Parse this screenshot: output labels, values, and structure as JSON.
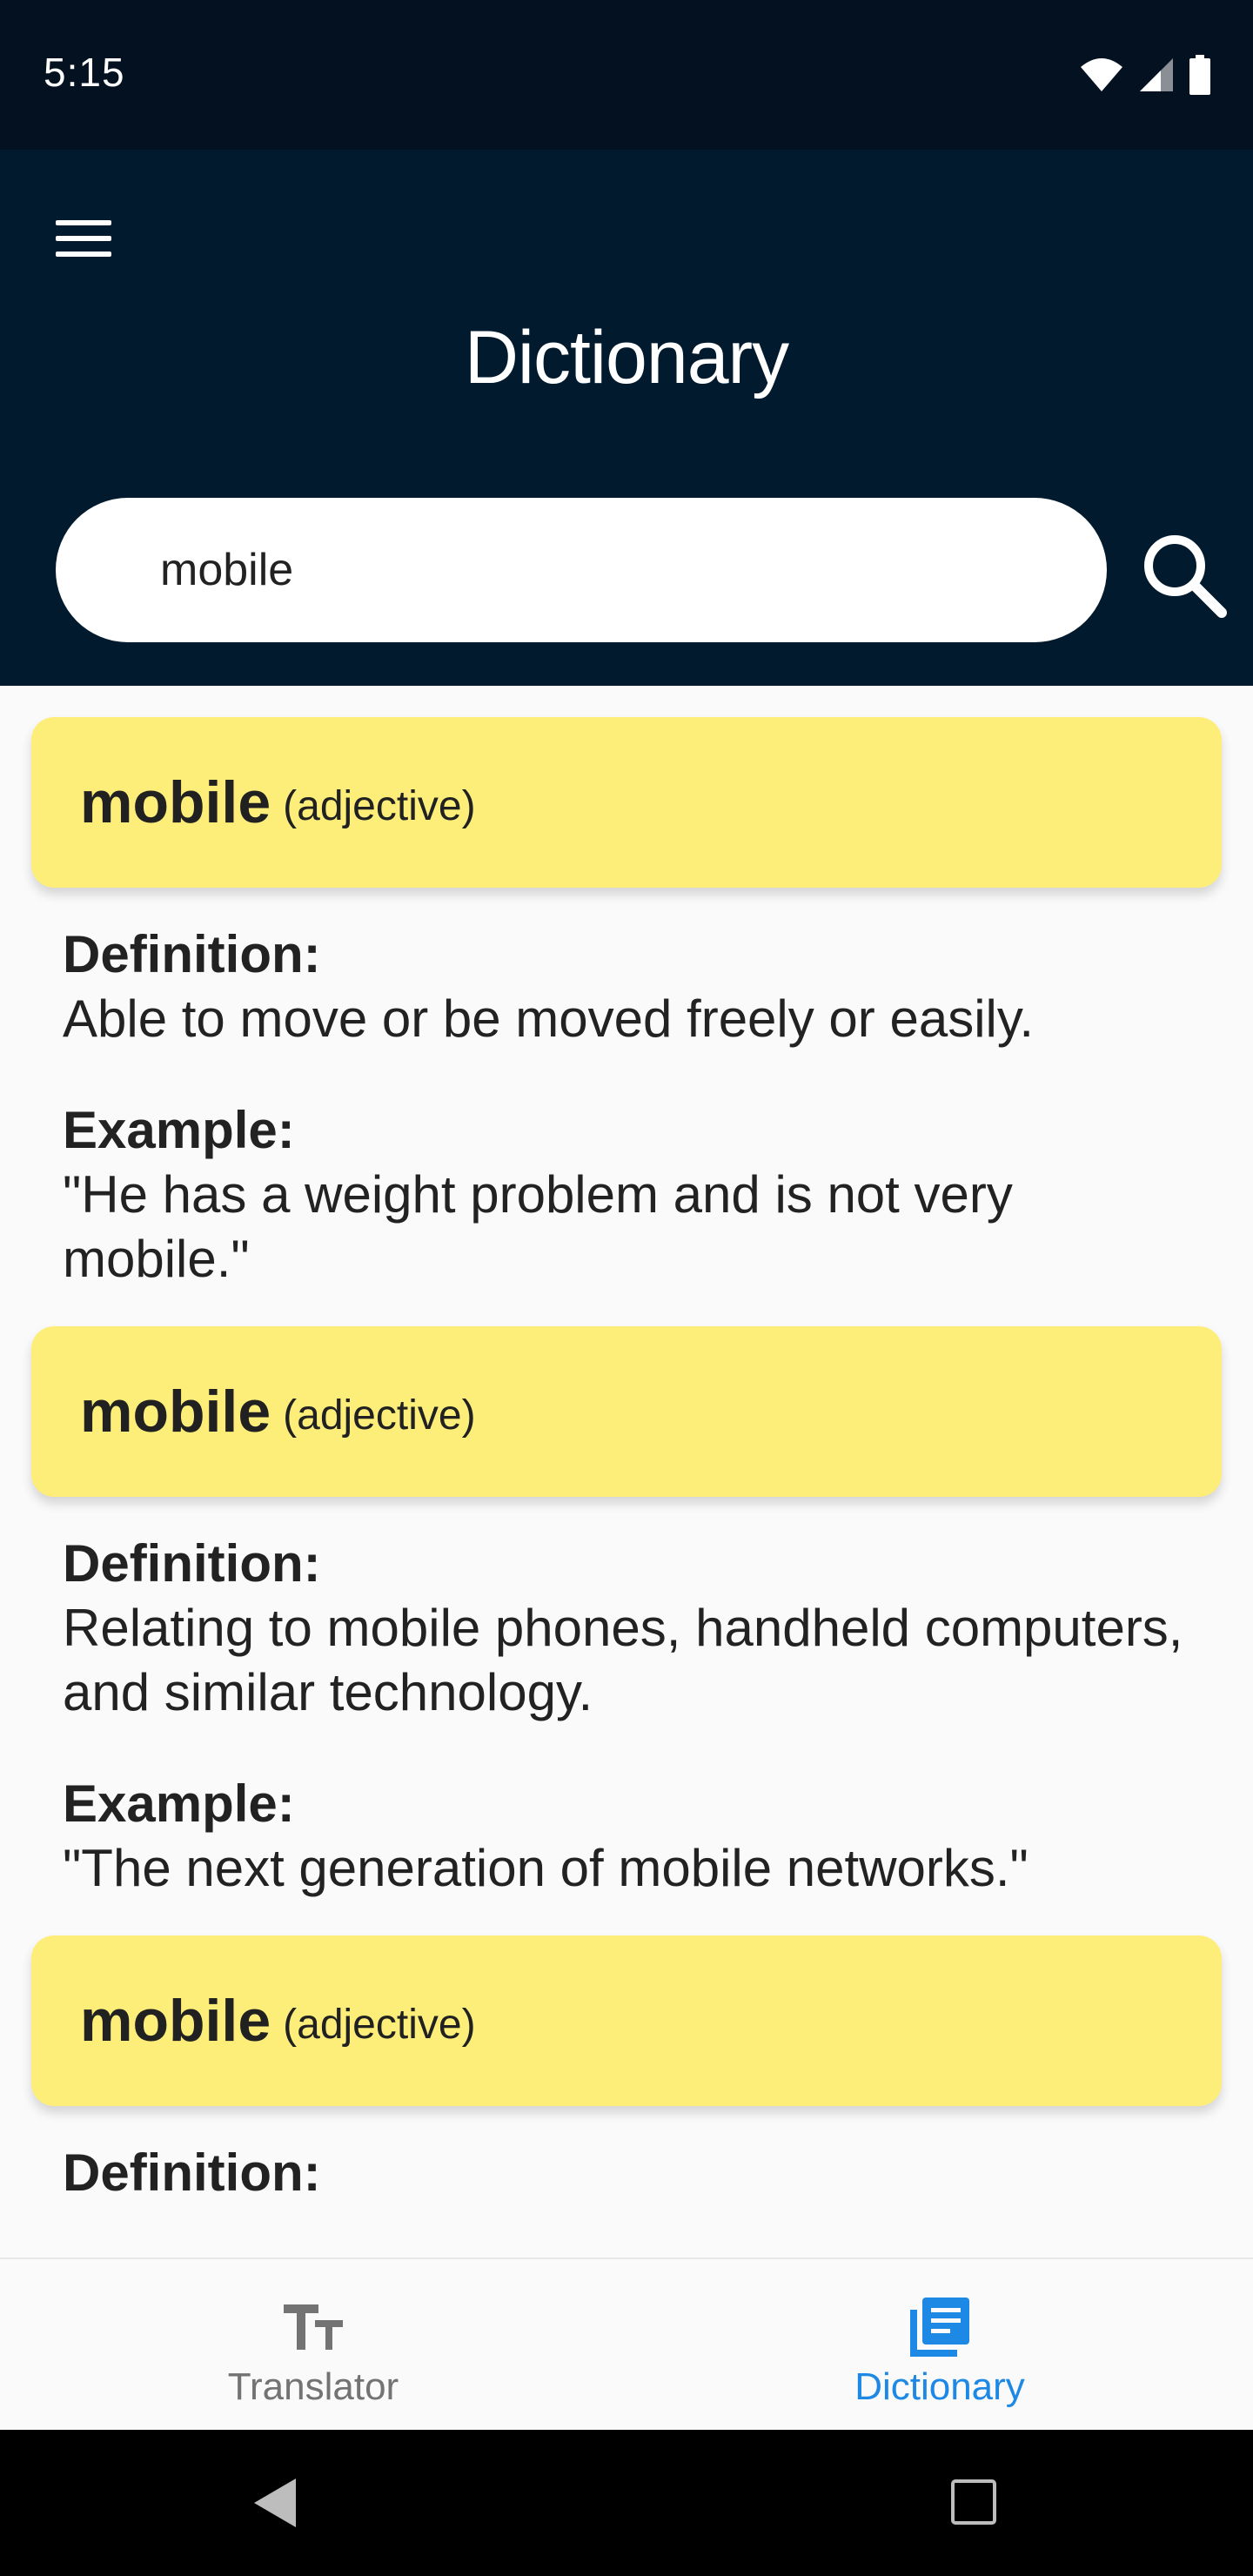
{
  "status_bar": {
    "time": "5:15"
  },
  "app_bar": {
    "title": "Dictionary",
    "menu_icon": "hamburger-menu-icon"
  },
  "search": {
    "value": "mobile",
    "icon": "search-icon"
  },
  "entries": [
    {
      "word": "mobile",
      "part_of_speech": "(adjective)",
      "definition_label": "Definition:",
      "definition": "Able to move or be moved freely or easily.",
      "example_label": "Example:",
      "example": "\"He has a weight problem and is not very mobile.\""
    },
    {
      "word": "mobile",
      "part_of_speech": "(adjective)",
      "definition_label": "Definition:",
      "definition": "Relating to mobile phones, handheld computers, and similar technology.",
      "example_label": "Example:",
      "example": "\"The next generation of mobile networks.\""
    },
    {
      "word": "mobile",
      "part_of_speech": "(adjective)",
      "definition_label": "Definition:"
    }
  ],
  "bottom_nav": {
    "items": [
      {
        "label": "Translator",
        "icon": "text-size-icon",
        "active": false
      },
      {
        "label": "Dictionary",
        "icon": "dictionary-icon",
        "active": true
      }
    ],
    "active_color": "#1e88e5",
    "inactive_color": "#737373"
  },
  "colors": {
    "status_bar": "#031121",
    "app_bar": "#011a2d",
    "entry_header": "#fdee7a"
  }
}
